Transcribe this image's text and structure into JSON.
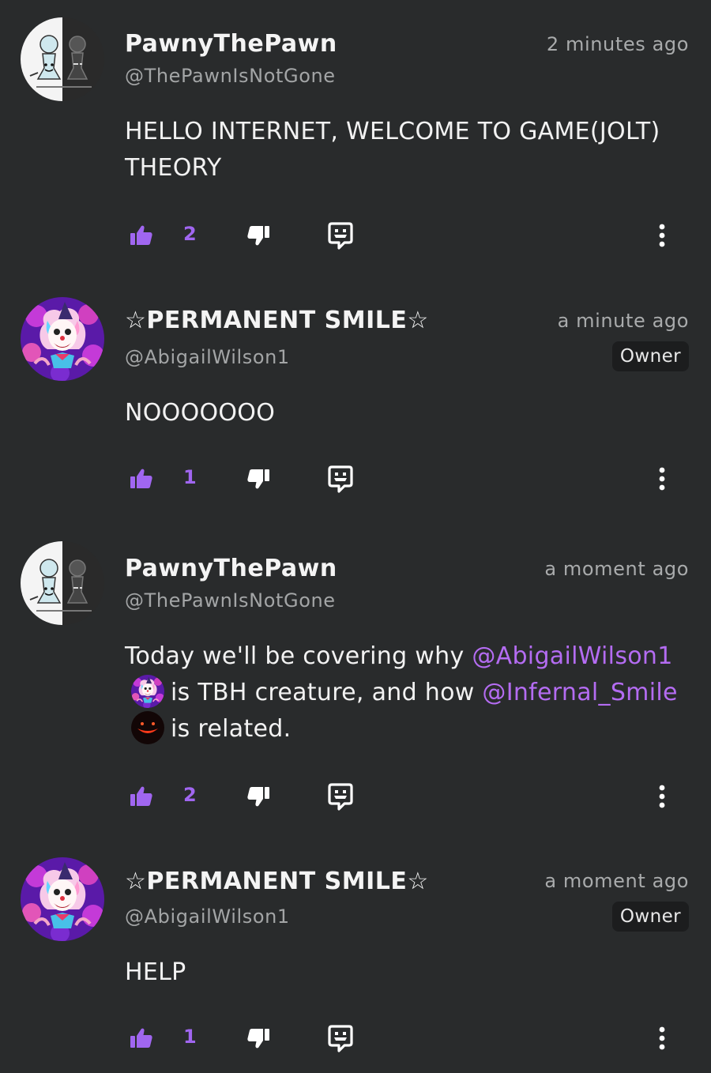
{
  "colors": {
    "background": "#292b2c",
    "accent_purple": "#a066f0",
    "mention": "#b46cf2",
    "badge_bg": "#1c1d1e"
  },
  "comments": [
    {
      "name": "PawnyThePawn",
      "handle": "@ThePawnIsNotGone",
      "time": "2 minutes ago",
      "badge": "",
      "avatar": "pawn-avatar",
      "body": "HELLO INTERNET, WELCOME TO GAME(JOLT) THEORY",
      "likes": "2"
    },
    {
      "name": "☆PERMANENT SMILE☆",
      "handle": "@AbigailWilson1",
      "time": "a minute ago",
      "badge": "Owner",
      "avatar": "clown-avatar",
      "body": "NOOOOOOO",
      "likes": "1"
    },
    {
      "name": "PawnyThePawn",
      "handle": "@ThePawnIsNotGone",
      "time": "a moment ago",
      "badge": "",
      "avatar": "pawn-avatar",
      "body_parts": {
        "p1": "Today we'll be covering why ",
        "mention1": "@AbigailWilson1",
        "p2": "is TBH creature, and how ",
        "mention2": "@Infernal_Smile",
        "p3": "is related."
      },
      "likes": "2"
    },
    {
      "name": "☆PERMANENT SMILE☆",
      "handle": "@AbigailWilson1",
      "time": "a moment ago",
      "badge": "Owner",
      "avatar": "clown-avatar",
      "body": "HELP",
      "likes": "1"
    }
  ],
  "icons": {
    "like": "thumbs-up-icon",
    "dislike": "thumbs-down-icon",
    "reply": "reply-bubble-icon",
    "more": "more-vertical-icon"
  }
}
